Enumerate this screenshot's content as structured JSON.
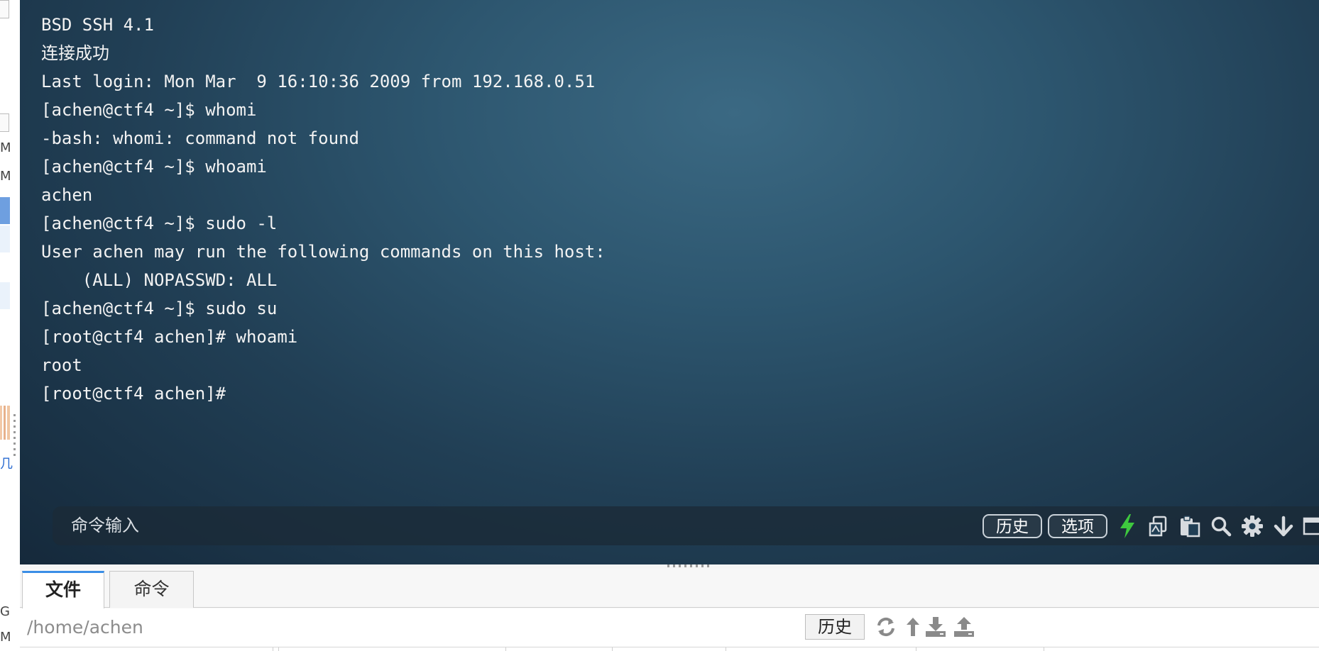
{
  "terminal": {
    "lines": [
      "BSD SSH 4.1",
      "连接成功",
      "Last login: Mon Mar  9 16:10:36 2009 from 192.168.0.51",
      "[achen@ctf4 ~]$ whomi",
      "-bash: whomi: command not found",
      "[achen@ctf4 ~]$ whoami",
      "achen",
      "[achen@ctf4 ~]$ sudo -l",
      "User achen may run the following commands on this host:",
      "    (ALL) NOPASSWD: ALL",
      "[achen@ctf4 ~]$ sudo su",
      "[root@ctf4 achen]# whoami",
      "root",
      "[root@ctf4 achen]#"
    ]
  },
  "command_bar": {
    "placeholder": "命令输入",
    "history_label": "历史",
    "options_label": "选项",
    "icons": [
      "bolt-icon",
      "copy-icon",
      "paste-icon",
      "search-icon",
      "gear-icon",
      "arrow-down-icon",
      "window-icon"
    ]
  },
  "bottom_panel": {
    "tabs": [
      {
        "label": "文件",
        "active": true
      },
      {
        "label": "命令",
        "active": false
      }
    ],
    "path": "/home/achen",
    "history_label": "历史",
    "tool_icons": [
      "refresh-icon",
      "up-arrow-icon",
      "download-icon",
      "upload-icon"
    ]
  },
  "left_sidebar": {
    "partial_glyphs": [
      "M",
      "M",
      "几",
      "G",
      "M"
    ]
  },
  "colors": {
    "terminal_text": "#f3f3f3",
    "terminal_bg": "#2d566f",
    "accent_green": "#3ec83e",
    "tab_accent": "#3a8ee6"
  }
}
